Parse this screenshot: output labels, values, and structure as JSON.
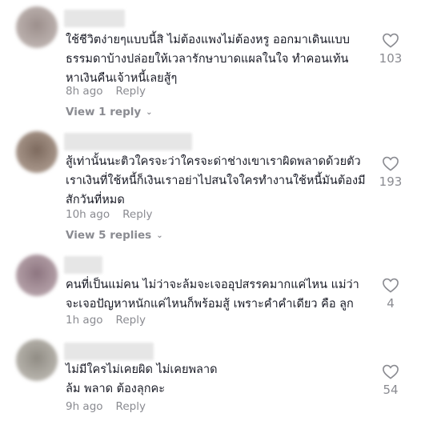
{
  "comments": [
    {
      "text": "ใช้ชีวิตง่ายๆแบบนี้สิ ไม่ต้องแพงไม่ต้องหรู ออกมาเดินแบบธรรมดาบ้างปล่อยให้เวลารักษาบาดแผลในใจ ทำคอนเท้นหาเงินคืนเจ้าหนี้เลยสู้ๆ",
      "time": "8h ago",
      "reply": "Reply",
      "view_replies": "View 1 reply",
      "likes": "103",
      "avatar_color": "#b5a9a6"
    },
    {
      "text": "สู้เท่านั้นนะติวใครจะว่าใครจะด่าช่างเขาเราผิดพลาดด้วยตัวเราเงินที่ใช้หนี้ก็เงินเราอย่าไปสนใจใครทำงานใช้หนี้มันต้องมีสักวันที่หมด",
      "time": "10h ago",
      "reply": "Reply",
      "view_replies": "View 5 replies",
      "likes": "193",
      "avatar_color": "#a08d80"
    },
    {
      "text": "คนที่เป็นแม่คน ไม่ว่าจะล้มจะเจออุปสรรคมากแค่ไหน แม่ว่าจะเจอปัญหาหนักแค่ไหนก็พร้อมสู้ เพราะคำคำเดียว คือ ลูก",
      "time": "1h ago",
      "reply": "Reply",
      "likes": "4",
      "avatar_color": "#a68e95"
    },
    {
      "text": "ไม่มีใครไม่เคยผิด ไม่เคยพลาด\nล้ม พลาด ต้องลุกคะ",
      "time": "9h ago",
      "reply": "Reply",
      "likes": "54",
      "avatar_color": "#a9a6a0"
    }
  ]
}
